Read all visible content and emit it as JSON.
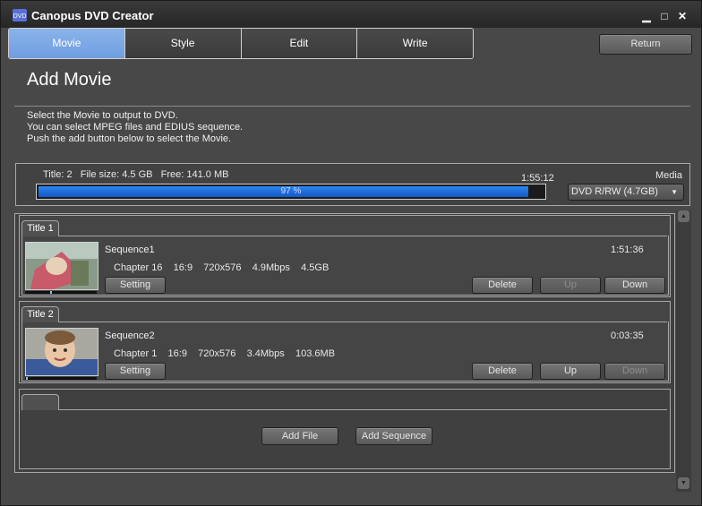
{
  "window": {
    "title": "Canopus DVD Creator",
    "minimize": "▁",
    "maximize": "□",
    "close": "✕"
  },
  "tabs": [
    "Movie",
    "Style",
    "Edit",
    "Write"
  ],
  "active_tab": "Movie",
  "return_label": "Return",
  "page_title": "Add Movie",
  "description": [
    "Select the Movie to output to DVD.",
    "You can select MPEG files and EDIUS sequence.",
    "Push the add button below to select the Movie."
  ],
  "status": {
    "info": "Title: 2   File size: 4.5 GB   Free: 141.0 MB",
    "total_time": "1:55:12",
    "progress_text": "97 %",
    "progress": 0.97,
    "media_label": "Media",
    "media_value": "DVD R/RW (4.7GB)"
  },
  "titles": [
    {
      "tab": "Title 1",
      "sequence": "Sequence1",
      "details": "Chapter 16    16:9    720x576    4.9Mbps    4.5GB",
      "duration": "1:51:36",
      "setting": "Setting",
      "delete": "Delete",
      "up": "Up",
      "down": "Down",
      "up_enabled": false,
      "down_enabled": true
    },
    {
      "tab": "Title 2",
      "sequence": "Sequence2",
      "details": "Chapter 1    16:9    720x576    3.4Mbps    103.6MB",
      "duration": "0:03:35",
      "setting": "Setting",
      "delete": "Delete",
      "up": "Up",
      "down": "Down",
      "up_enabled": true,
      "down_enabled": false
    }
  ],
  "add": {
    "add_file": "Add File",
    "add_sequence": "Add Sequence"
  },
  "colors": {
    "accent": "#7ea8e4",
    "progress": "#1a6ee0",
    "background": "#484848"
  }
}
